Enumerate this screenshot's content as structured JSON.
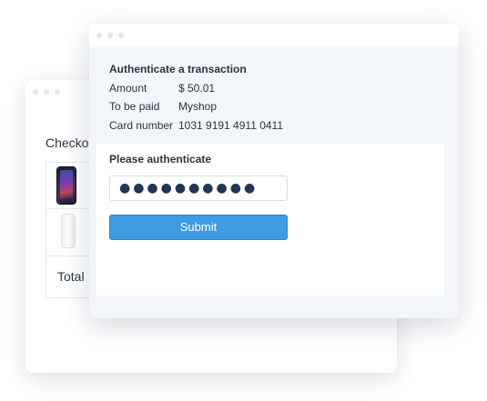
{
  "checkout_window": {
    "title": "Checkout",
    "items": [
      {
        "icon": "smartphone-image"
      },
      {
        "icon": "power-bank-image"
      }
    ],
    "total_label": "Total"
  },
  "auth_window": {
    "heading": "Authenticate a transaction",
    "details": {
      "amount_label": "Amount",
      "amount_value": "$ 50.01",
      "payee_label": "To be paid",
      "payee_value": "Myshop",
      "card_label": "Card number",
      "card_value": "1031 9191 4911 0411"
    },
    "prompt": "Please authenticate",
    "password_value": "●●●●●●●●●●",
    "submit_label": "Submit"
  },
  "colors": {
    "accent": "#3d9be2",
    "panel_bg": "#f2f6fb",
    "text": "#2a3442"
  }
}
